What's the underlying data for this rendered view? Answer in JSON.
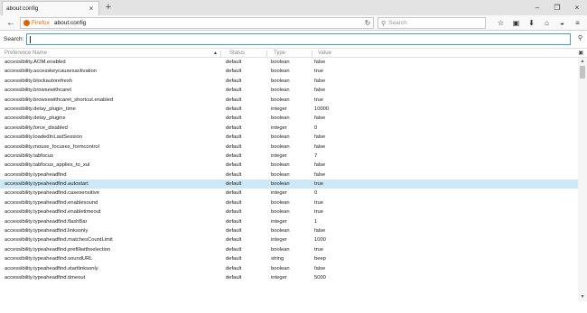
{
  "tab": {
    "title": "about:config",
    "close": "×",
    "new_tab": "+"
  },
  "window_controls": {
    "minimize": "–",
    "restore": "❐",
    "close": "×"
  },
  "nav": {
    "back": "←",
    "identity": "Firefox",
    "url": "about:config",
    "reload": "↻",
    "search_placeholder": "Search",
    "icons": [
      "star-icon",
      "library-icon",
      "download-icon",
      "home-icon",
      "pocket-icon",
      "menu-icon"
    ]
  },
  "filter": {
    "label": "Search:",
    "value": ""
  },
  "table": {
    "headers": {
      "name": "Preference Name",
      "status": "Status",
      "type": "Type",
      "value": "Value"
    },
    "rows": [
      {
        "name": "accessibility.AOM.enabled",
        "status": "default",
        "type": "boolean",
        "value": "false"
      },
      {
        "name": "accessibility.accesskeycausesactivation",
        "status": "default",
        "type": "boolean",
        "value": "true"
      },
      {
        "name": "accessibility.blockautorefresh",
        "status": "default",
        "type": "boolean",
        "value": "false"
      },
      {
        "name": "accessibility.browsewithcaret",
        "status": "default",
        "type": "boolean",
        "value": "false"
      },
      {
        "name": "accessibility.browsewithcaret_shortcut.enabled",
        "status": "default",
        "type": "boolean",
        "value": "true"
      },
      {
        "name": "accessibility.delay_plugin_time",
        "status": "default",
        "type": "integer",
        "value": "10000"
      },
      {
        "name": "accessibility.delay_plugins",
        "status": "default",
        "type": "boolean",
        "value": "false"
      },
      {
        "name": "accessibility.force_disabled",
        "status": "default",
        "type": "integer",
        "value": "0"
      },
      {
        "name": "accessibility.loadedInLastSession",
        "status": "default",
        "type": "boolean",
        "value": "false"
      },
      {
        "name": "accessibility.mouse_focuses_formcontrol",
        "status": "default",
        "type": "boolean",
        "value": "false"
      },
      {
        "name": "accessibility.tabfocus",
        "status": "default",
        "type": "integer",
        "value": "7"
      },
      {
        "name": "accessibility.tabfocus_applies_to_xul",
        "status": "default",
        "type": "boolean",
        "value": "false"
      },
      {
        "name": "accessibility.typeaheadfind",
        "status": "default",
        "type": "boolean",
        "value": "false"
      },
      {
        "name": "accessibility.typeaheadfind.autostart",
        "status": "default",
        "type": "boolean",
        "value": "true"
      },
      {
        "name": "accessibility.typeaheadfind.casesensitive",
        "status": "default",
        "type": "integer",
        "value": "0"
      },
      {
        "name": "accessibility.typeaheadfind.enablesound",
        "status": "default",
        "type": "boolean",
        "value": "true"
      },
      {
        "name": "accessibility.typeaheadfind.enabletimeout",
        "status": "default",
        "type": "boolean",
        "value": "true"
      },
      {
        "name": "accessibility.typeaheadfind.flashBar",
        "status": "default",
        "type": "integer",
        "value": "1"
      },
      {
        "name": "accessibility.typeaheadfind.linksonly",
        "status": "default",
        "type": "boolean",
        "value": "false"
      },
      {
        "name": "accessibility.typeaheadfind.matchesCountLimit",
        "status": "default",
        "type": "integer",
        "value": "1000"
      },
      {
        "name": "accessibility.typeaheadfind.prefillwithselection",
        "status": "default",
        "type": "boolean",
        "value": "true"
      },
      {
        "name": "accessibility.typeaheadfind.soundURL",
        "status": "default",
        "type": "string",
        "value": "beep"
      },
      {
        "name": "accessibility.typeaheadfind.startlinksonly",
        "status": "default",
        "type": "boolean",
        "value": "false"
      },
      {
        "name": "accessibility.typeaheadfind.timeout",
        "status": "default",
        "type": "integer",
        "value": "5000"
      }
    ],
    "selected_index": 13
  },
  "scrollbar": {
    "up": "▲",
    "down": "▼"
  }
}
